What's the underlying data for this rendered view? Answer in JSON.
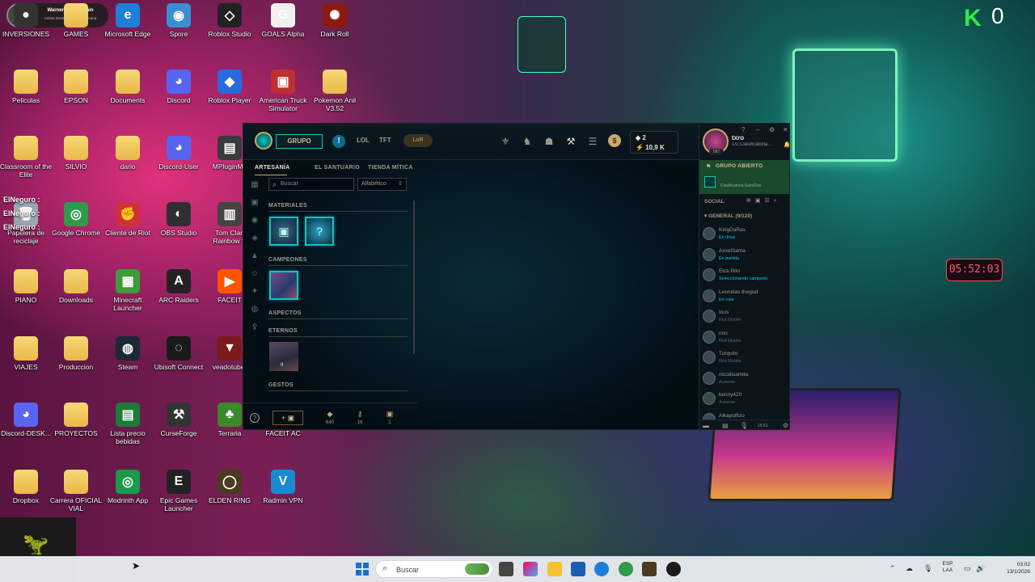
{
  "overlay": {
    "k_count": "0",
    "k_logo": "K",
    "clock": "05:52:03"
  },
  "profile_chip": {
    "name": "Warner Music Spain",
    "subtitle": "Artista Destacado de la Semana"
  },
  "desktop_icons": [
    {
      "label": "INVERSIONES",
      "kind": "app",
      "color": "#333333",
      "glyph": "●"
    },
    {
      "label": "GAMES",
      "kind": "folder"
    },
    {
      "label": "Microsoft Edge",
      "kind": "app",
      "color": "#1e7fd8",
      "glyph": "e"
    },
    {
      "label": "Spore",
      "kind": "app",
      "color": "#3a8fd0",
      "glyph": "◉"
    },
    {
      "label": "Roblox Studio",
      "kind": "app",
      "color": "#222222",
      "glyph": "◇"
    },
    {
      "label": "GOALS Alpha",
      "kind": "app",
      "color": "#f0f0f0",
      "glyph": "G"
    },
    {
      "label": "Dark Roll",
      "kind": "app",
      "color": "#8a1a10",
      "glyph": "✺"
    },
    {
      "label": "Peliculas",
      "kind": "folder"
    },
    {
      "label": "EPSON",
      "kind": "folder"
    },
    {
      "label": "Documents",
      "kind": "folder"
    },
    {
      "label": "Discord",
      "kind": "app",
      "color": "#5865f2",
      "glyph": "◕"
    },
    {
      "label": "Roblox Player",
      "kind": "app",
      "color": "#2a6adf",
      "glyph": "◆"
    },
    {
      "label": "American Truck Simulator",
      "kind": "app",
      "color": "#c03030",
      "glyph": "▣"
    },
    {
      "label": "Pokemon Anil V3.52",
      "kind": "folder"
    },
    {
      "label": "Classroom of the Elite",
      "kind": "folder"
    },
    {
      "label": "SILVIO",
      "kind": "folder"
    },
    {
      "label": "dario",
      "kind": "folder"
    },
    {
      "label": "Discord-User",
      "kind": "app",
      "color": "#5865f2",
      "glyph": "◕"
    },
    {
      "label": "MPluginMa",
      "kind": "app",
      "color": "#3a3a3a",
      "glyph": "▤"
    },
    {
      "label": "Papelera de reciclaje",
      "kind": "app",
      "color": "#9aa6b0",
      "glyph": "🗑"
    },
    {
      "label": "Google Chrome",
      "kind": "app",
      "color": "#2f9a4a",
      "glyph": "◎"
    },
    {
      "label": "Cliente de Riot",
      "kind": "app",
      "color": "#d0303a",
      "glyph": "✊"
    },
    {
      "label": "OBS Studio",
      "kind": "app",
      "color": "#302e31",
      "glyph": "◐"
    },
    {
      "label": "Tom Clan Rainbow S",
      "kind": "app",
      "color": "#444444",
      "glyph": "▥"
    },
    {
      "label": "PIANO",
      "kind": "folder"
    },
    {
      "label": "Downloads",
      "kind": "folder"
    },
    {
      "label": "Minecraft Launcher",
      "kind": "app",
      "color": "#3f9a3a",
      "glyph": "▦"
    },
    {
      "label": "ARC Raiders",
      "kind": "app",
      "color": "#222222",
      "glyph": "A"
    },
    {
      "label": "FACEIT",
      "kind": "app",
      "color": "#ff5500",
      "glyph": "▶"
    },
    {
      "label": "VIAJES",
      "kind": "folder"
    },
    {
      "label": "Produccion",
      "kind": "folder"
    },
    {
      "label": "Steam",
      "kind": "app",
      "color": "#1b2838",
      "glyph": "◍"
    },
    {
      "label": "Ubisoft Connect",
      "kind": "app",
      "color": "#1a1a1a",
      "glyph": "◌"
    },
    {
      "label": "veadotube-",
      "kind": "app",
      "color": "#7a1a1a",
      "glyph": "▼"
    },
    {
      "label": "Discord-DESK...",
      "kind": "app",
      "color": "#5865f2",
      "glyph": "◕"
    },
    {
      "label": "PROYECTOS",
      "kind": "folder"
    },
    {
      "label": "Lista precio bebidas",
      "kind": "app",
      "color": "#1e7a3a",
      "glyph": "▤"
    },
    {
      "label": "CurseForge",
      "kind": "app",
      "color": "#333333",
      "glyph": "⚒"
    },
    {
      "label": "Terraria",
      "kind": "app",
      "color": "#3a8a2a",
      "glyph": "♣"
    },
    {
      "label": "FACEIT AC",
      "kind": "none"
    },
    {
      "label": "Dropbox",
      "kind": "folder"
    },
    {
      "label": "Carrera OFICIAL VIAL",
      "kind": "folder"
    },
    {
      "label": "Modrinth App",
      "kind": "app",
      "color": "#1a9a4a",
      "glyph": "◎"
    },
    {
      "label": "Epic Games Launcher",
      "kind": "app",
      "color": "#222222",
      "glyph": "E"
    },
    {
      "label": "ELDEN RING",
      "kind": "app",
      "color": "#4a3a20",
      "glyph": "◯"
    },
    {
      "label": "Radmin VPN",
      "kind": "app",
      "color": "#1a8ad0",
      "glyph": "V"
    }
  ],
  "notification_chips": [
    "ElNeguro :",
    "ElNeguro :",
    "ElNeguro :"
  ],
  "client": {
    "top_nav": {
      "group_button": "GRUPO",
      "info_glyph": "!",
      "lol": "LOL",
      "tft": "TFT",
      "lor": "LoR"
    },
    "currency": {
      "blue_essence": "2",
      "riot_points": "10,9 K"
    },
    "sub_nav": [
      "ARTESANÍA",
      "EL SANTUARIO",
      "TIENDA MÍTICA"
    ],
    "search": {
      "placeholder": "Buscar",
      "icon": "search-icon"
    },
    "sort": {
      "value": "Alfabético"
    },
    "sections": {
      "materials": "MATERIALES",
      "champions": "CAMPEONES",
      "skins": "ASPECTOS",
      "eternals": "ETERNOS",
      "emotes": "GESTOS"
    },
    "eternal_badge": "II",
    "bottom_stats": [
      {
        "icon": "orange-essence-icon",
        "glyph": "◆",
        "value": "640"
      },
      {
        "icon": "key-fragment-icon",
        "glyph": "⚷",
        "value": "16"
      },
      {
        "icon": "chest-icon",
        "glyph": "▣",
        "value": "1"
      }
    ],
    "add_button": "+ ▣"
  },
  "social": {
    "summoner_name": "txro",
    "summoner_status": "1/2 Clasificatoria...",
    "level": "587",
    "open_group": "GRUPO ABIERTO",
    "open_group_mode": "Clasificatoria Solo/Dúo",
    "label": "SOCIAL",
    "general_group": "GENERAL (9/120)",
    "friends": [
      {
        "name": "KingDaRas",
        "status": "En línea",
        "tone": "green"
      },
      {
        "name": "AxxelSama",
        "status": "En partida",
        "tone": "blue"
      },
      {
        "name": "Elca Rito",
        "status": "Seleccionando campeón",
        "tone": "blue"
      },
      {
        "name": "Leonidas thegod",
        "status": "En cola",
        "tone": "blue"
      },
      {
        "name": "Ious",
        "status": "Riot Mobile",
        "tone": "grey"
      },
      {
        "name": "nnn",
        "status": "Riot Mobile",
        "tone": "grey"
      },
      {
        "name": "Turquito",
        "status": "Riot Mobile",
        "tone": "grey"
      },
      {
        "name": "nicodisamita",
        "status": "Ausente",
        "tone": "grey"
      },
      {
        "name": "kenny420",
        "status": "Ausente",
        "tone": "grey"
      },
      {
        "name": "Alkapuffizo",
        "status": "",
        "tone": "grey"
      }
    ],
    "bottom_time": "15:51"
  },
  "taskbar": {
    "search_text": "Buscar",
    "lang_top": "ESP",
    "lang_bottom": "LAA",
    "time": "03:02",
    "date": "13/1/2026"
  }
}
